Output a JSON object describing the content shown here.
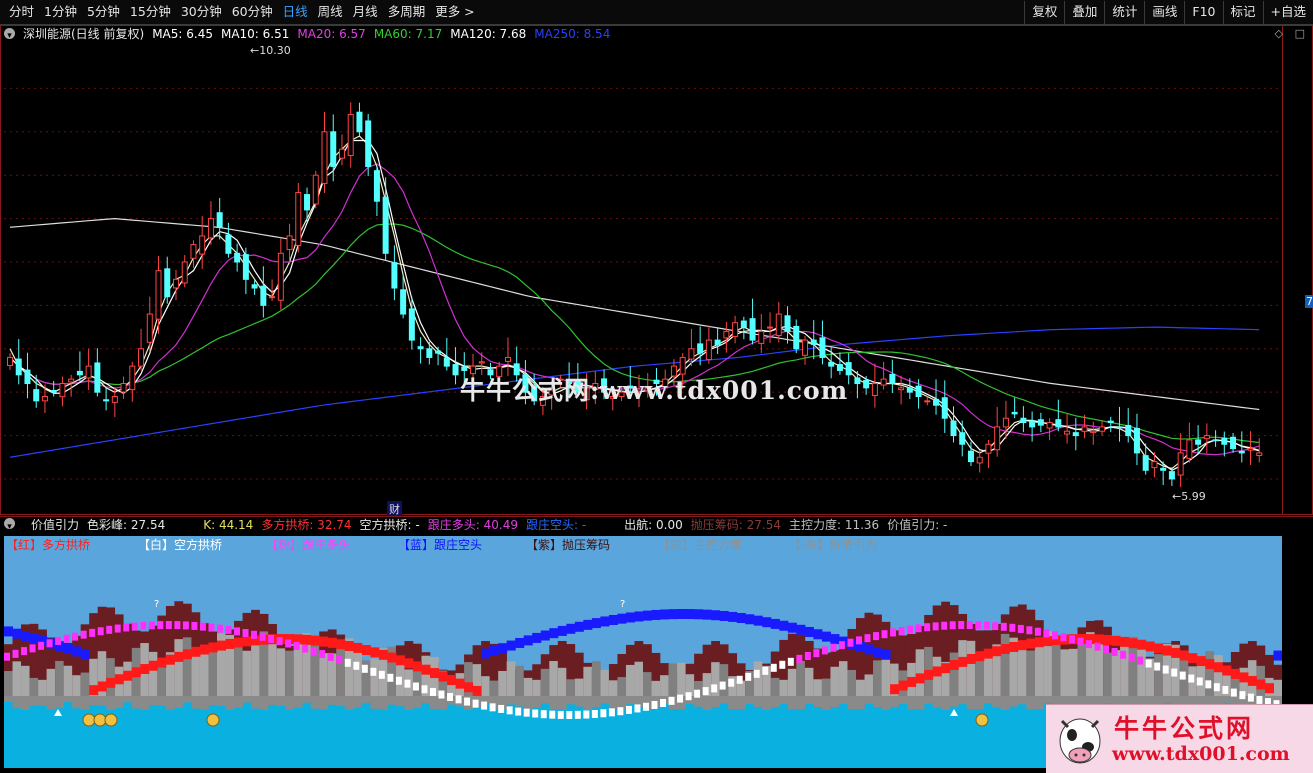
{
  "toolbar": {
    "periods": [
      "分时",
      "1分钟",
      "5分钟",
      "15分钟",
      "30分钟",
      "60分钟",
      "日线",
      "周线",
      "月线",
      "多周期",
      "更多 >"
    ],
    "active_period": "日线",
    "right_buttons": [
      "复权",
      "叠加",
      "统计",
      "画线",
      "F10",
      "标记",
      "+自选"
    ]
  },
  "main_info": {
    "stock": "深圳能源(日线 前复权)",
    "ma": [
      {
        "label": "MA5: 6.45",
        "color": "#ffffff"
      },
      {
        "label": "MA10: 6.51",
        "color": "#ffffff"
      },
      {
        "label": "MA20: 6.57",
        "color": "#e040e0"
      },
      {
        "label": "MA60: 7.17",
        "color": "#30d030"
      },
      {
        "label": "MA120: 7.68",
        "color": "#ffffff"
      },
      {
        "label": "MA250: 8.54",
        "color": "#2a40ff"
      }
    ]
  },
  "chart_data": {
    "type": "candlestick",
    "high_label": "10.30",
    "low_label": "5.99",
    "event_label": "财",
    "right_edge_label": "7",
    "up_color": "#ff4444",
    "down_color": "#54ffff",
    "ylim": [
      5.7,
      11.0
    ],
    "closes": [
      7.4,
      7.2,
      7.1,
      6.9,
      6.95,
      7.0,
      7.1,
      7.15,
      7.2,
      7.3,
      7.0,
      6.9,
      6.95,
      7.1,
      7.3,
      7.5,
      7.9,
      8.4,
      8.1,
      8.3,
      8.5,
      8.7,
      8.8,
      9.0,
      8.9,
      8.6,
      8.5,
      8.3,
      8.2,
      8.0,
      8.1,
      8.6,
      8.8,
      9.3,
      9.1,
      9.5,
      10.0,
      9.6,
      9.8,
      10.2,
      10.0,
      9.6,
      9.2,
      8.6,
      8.2,
      7.9,
      7.6,
      7.5,
      7.4,
      7.45,
      7.3,
      7.2,
      7.25,
      7.3,
      7.35,
      7.2,
      7.3,
      7.4,
      7.2,
      7.0,
      6.9,
      6.95,
      7.05,
      7.15,
      7.1,
      7.0,
      7.05,
      7.1,
      7.0,
      6.95,
      7.0,
      7.05,
      7.0,
      7.05,
      7.1,
      7.15,
      7.3,
      7.4,
      7.5,
      7.45,
      7.6,
      7.55,
      7.7,
      7.8,
      7.75,
      7.6,
      7.7,
      7.75,
      7.9,
      7.7,
      7.5,
      7.6,
      7.55,
      7.4,
      7.3,
      7.25,
      7.2,
      7.1,
      7.05,
      7.1,
      7.15,
      7.1,
      7.05,
      7.0,
      6.95,
      6.9,
      6.85,
      6.7,
      6.5,
      6.4,
      6.2,
      6.25,
      6.4,
      6.6,
      6.7,
      6.75,
      6.65,
      6.6,
      6.62,
      6.65,
      6.6,
      6.55,
      6.5,
      6.6,
      6.55,
      6.6,
      6.65,
      6.6,
      6.5,
      6.3,
      6.1,
      6.2,
      6.1,
      6.0,
      6.3,
      6.45,
      6.4,
      6.5,
      6.45,
      6.4,
      6.35,
      6.3,
      6.35,
      6.3
    ],
    "ma": {
      "MA5": [
        7.5,
        7.3,
        7.2,
        7.1,
        7.05,
        7.0,
        7.05,
        7.1,
        7.15,
        7.2,
        7.15,
        7.05,
        7.0,
        7.05,
        7.15,
        7.3,
        7.55,
        7.9,
        8.15,
        8.3,
        8.35,
        8.55,
        8.7,
        8.8,
        8.8,
        8.7,
        8.6,
        8.45,
        8.3,
        8.15,
        8.1,
        8.3,
        8.5,
        8.8,
        9.0,
        9.2,
        9.5,
        9.7,
        9.8,
        9.9,
        9.95,
        9.85,
        9.6,
        9.2,
        8.8,
        8.35,
        7.95,
        7.7,
        7.55,
        7.45,
        7.4,
        7.35,
        7.3,
        7.3,
        7.3,
        7.28,
        7.28,
        7.3,
        7.28,
        7.2,
        7.1,
        7.0,
        7.0,
        7.05,
        7.05,
        7.05,
        7.05,
        7.05,
        7.05,
        7.03,
        7.0,
        7.0,
        7.0,
        7.02,
        7.05,
        7.1,
        7.2,
        7.3,
        7.4,
        7.45,
        7.5,
        7.55,
        7.6,
        7.7,
        7.75,
        7.7,
        7.7,
        7.7,
        7.75,
        7.7,
        7.6,
        7.6,
        7.55,
        7.45,
        7.35,
        7.3,
        7.25,
        7.15,
        7.1,
        7.1,
        7.1,
        7.1,
        7.08,
        7.05,
        7.0,
        6.95,
        6.9,
        6.8,
        6.65,
        6.5,
        6.35,
        6.3,
        6.35,
        6.45,
        6.55,
        6.65,
        6.68,
        6.66,
        6.65,
        6.64,
        6.62,
        6.6,
        6.57,
        6.58,
        6.57,
        6.58,
        6.6,
        6.58,
        6.53,
        6.4,
        6.25,
        6.2,
        6.15,
        6.12,
        6.2,
        6.3,
        6.35,
        6.42,
        6.45,
        6.44,
        6.42,
        6.38,
        6.36,
        6.33
      ]
    }
  },
  "sub_info": {
    "title": "价值引力",
    "fields": [
      {
        "label": "色彩峰: 27.54",
        "color": "#e6e6e6"
      },
      {
        "label": "K: 44.14",
        "color": "#e0e060"
      },
      {
        "label": "多方拱桥: 32.74",
        "color": "#ff3030"
      },
      {
        "label": "空方拱桥: -",
        "color": "#e6e6e6"
      },
      {
        "label": "跟庄多头: 40.49",
        "color": "#e040e0"
      },
      {
        "label": "跟庄空头: -",
        "color": "#2a6aff"
      },
      {
        "label": "出航: 0.00",
        "color": "#e6e6e6"
      },
      {
        "label": "抛压筹码: 27.54",
        "color": "#8a3a3a"
      },
      {
        "label": "主控力度: 11.36",
        "color": "#c0c0c0"
      },
      {
        "label": "价值引力: -",
        "color": "#c0c0c0"
      }
    ],
    "legend": [
      {
        "label": "【红】多方拱桥",
        "color": "#ff2020"
      },
      {
        "label": "【白】空方拱桥",
        "color": "#ffffff"
      },
      {
        "label": "【粉】跟庄多头",
        "color": "#ff40ff"
      },
      {
        "label": "【蓝】跟庄空头",
        "color": "#1010ff"
      },
      {
        "label": "【紫】抛压筹码",
        "color": "#3a1010"
      },
      {
        "label": "【灰】主控力度",
        "color": "#909090"
      },
      {
        "label": "【-灰】价值引力",
        "color": "#909090"
      }
    ],
    "markers": [
      "?",
      "?"
    ]
  },
  "logo": {
    "title": "牛牛公式网",
    "url": "www.tdx001.com"
  },
  "watermark": "牛牛公式网:www.tdx001.com"
}
